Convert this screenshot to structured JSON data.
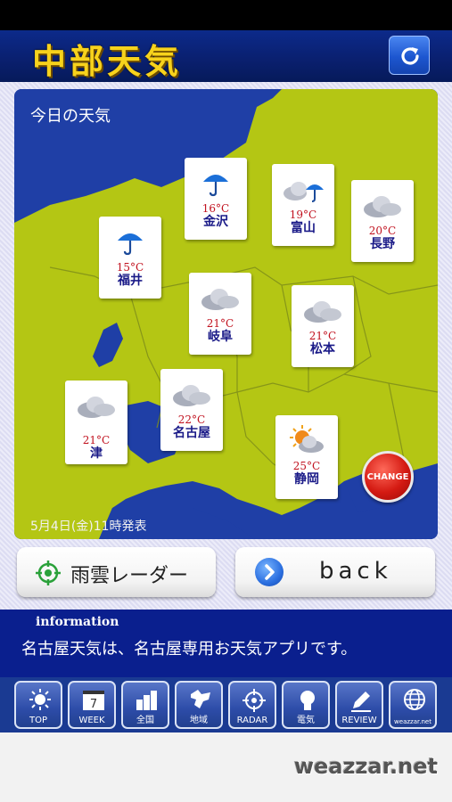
{
  "header": {
    "title": "中部天気",
    "refresh_icon": "refresh-icon"
  },
  "map": {
    "title": "今日の天気",
    "issued": "5月4日(金)11時発表",
    "cards": [
      {
        "city": "金沢",
        "temp": "16°C",
        "icon": "umbrella-icon"
      },
      {
        "city": "富山",
        "temp": "19°C",
        "icon": "cloud-rain-icon"
      },
      {
        "city": "長野",
        "temp": "20°C",
        "icon": "cloud-icon"
      },
      {
        "city": "福井",
        "temp": "15°C",
        "icon": "umbrella-icon"
      },
      {
        "city": "岐阜",
        "temp": "21°C",
        "icon": "cloud-icon"
      },
      {
        "city": "松本",
        "temp": "21°C",
        "icon": "cloud-icon"
      },
      {
        "city": "津",
        "temp": "21°C",
        "icon": "cloud-icon"
      },
      {
        "city": "名古屋",
        "temp": "22°C",
        "icon": "cloud-icon"
      },
      {
        "city": "静岡",
        "temp": "25°C",
        "icon": "sun-cloud-icon"
      }
    ],
    "change_label": "CHANGE"
  },
  "buttons": {
    "radar_label": "雨雲レーダー",
    "back_label": "back"
  },
  "info": {
    "label": "information",
    "text": "名古屋天気は、名古屋専用お天気アプリです。"
  },
  "tabs": [
    {
      "label": "TOP",
      "icon": "sun-icon"
    },
    {
      "label": "WEEK",
      "icon": "calendar-icon",
      "day": "7"
    },
    {
      "label": "全国",
      "icon": "bar-chart-icon"
    },
    {
      "label": "地域",
      "icon": "hokkaido-map-icon"
    },
    {
      "label": "RADAR",
      "icon": "crosshair-icon"
    },
    {
      "label": "電気",
      "icon": "lightbulb-icon"
    },
    {
      "label": "REVIEW",
      "icon": "pencil-icon"
    },
    {
      "label": "weazzar.net",
      "icon": "globe-icon"
    }
  ],
  "footer": {
    "brand": "weazzar.net"
  },
  "colors": {
    "header_bg": "#0a2070",
    "title_gold": "#f7d21c",
    "map_sea": "#1f3fa6",
    "land": "#b4c614",
    "info_bg": "#0a1f8e",
    "temp_red": "#c1121f"
  }
}
